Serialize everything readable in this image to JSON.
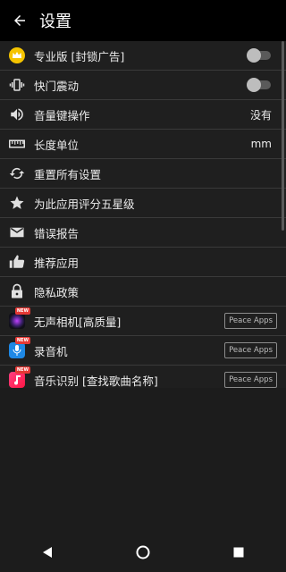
{
  "appbar": {
    "title": "设置"
  },
  "settings": {
    "items": [
      {
        "label": "专业版 [封锁广告]",
        "control": "toggle",
        "state": false
      },
      {
        "label": "快门震动",
        "control": "toggle",
        "state": false
      },
      {
        "label": "音量键操作",
        "value": "没有"
      },
      {
        "label": "长度单位",
        "value": "mm"
      },
      {
        "label": "重置所有设置"
      },
      {
        "label": "为此应用评分五星级"
      },
      {
        "label": "错误报告"
      },
      {
        "label": "推荐应用"
      },
      {
        "label": "隐私政策"
      }
    ],
    "promoted_apps": [
      {
        "label": "无声相机[高质量]",
        "badge": "Peace Apps",
        "new": "NEW"
      },
      {
        "label": "录音机",
        "badge": "Peace Apps",
        "new": "NEW"
      },
      {
        "label": "音乐识别 [查找歌曲名称]",
        "badge": "Peace Apps",
        "new": "NEW"
      }
    ]
  },
  "colors": {
    "background": "#1c1c1c",
    "appbar": "#000000",
    "pro_accent": "#f5c400"
  }
}
